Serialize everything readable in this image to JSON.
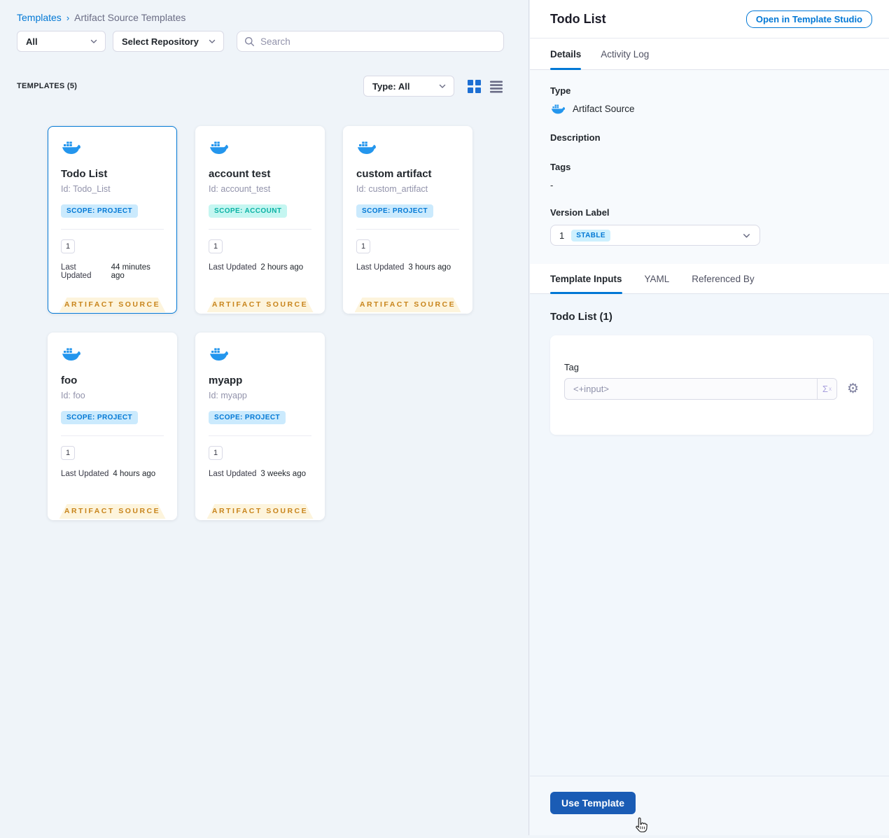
{
  "breadcrumb": {
    "link": "Templates",
    "separator": "›",
    "current": "Artifact Source Templates"
  },
  "filters": {
    "scope_dropdown": "All",
    "repository_dropdown": "Select Repository",
    "search_placeholder": "Search"
  },
  "list_header": {
    "count_label": "TEMPLATES (5)",
    "type_filter": "Type: All"
  },
  "cards": [
    {
      "title": "Todo List",
      "id": "Id: Todo_List",
      "scope": "SCOPE: PROJECT",
      "version_count": "1",
      "last_updated_label": "Last Updated",
      "last_updated": "44 minutes ago",
      "ribbon": "ARTIFACT SOURCE"
    },
    {
      "title": "account test",
      "id": "Id: account_test",
      "scope": "SCOPE: ACCOUNT",
      "version_count": "1",
      "last_updated_label": "Last Updated",
      "last_updated": "2 hours ago",
      "ribbon": "ARTIFACT SOURCE"
    },
    {
      "title": "custom artifact",
      "id": "Id: custom_artifact",
      "scope": "SCOPE: PROJECT",
      "version_count": "1",
      "last_updated_label": "Last Updated",
      "last_updated": "3 hours ago",
      "ribbon": "ARTIFACT SOURCE"
    },
    {
      "title": "foo",
      "id": "Id: foo",
      "scope": "SCOPE: PROJECT",
      "version_count": "1",
      "last_updated_label": "Last Updated",
      "last_updated": "4 hours ago",
      "ribbon": "ARTIFACT SOURCE"
    },
    {
      "title": "myapp",
      "id": "Id: myapp",
      "scope": "SCOPE: PROJECT",
      "version_count": "1",
      "last_updated_label": "Last Updated",
      "last_updated": "3 weeks ago",
      "ribbon": "ARTIFACT SOURCE"
    }
  ],
  "details_panel": {
    "title": "Todo List",
    "open_button": "Open in Template Studio",
    "tabs": [
      {
        "label": "Details"
      },
      {
        "label": "Activity Log"
      }
    ],
    "type_label": "Type",
    "type_value": "Artifact Source",
    "description_label": "Description",
    "tags_label": "Tags",
    "tags_value": "-",
    "version_label": "Version Label",
    "version_value": "1",
    "version_badge": "STABLE",
    "sub_tabs": [
      {
        "label": "Template Inputs"
      },
      {
        "label": "YAML"
      },
      {
        "label": "Referenced By"
      }
    ],
    "inputs_heading": "Todo List (1)",
    "tag_label": "Tag",
    "tag_value": "<+input>",
    "use_template_button": "Use Template"
  },
  "icons": {
    "expression": "Σ",
    "expression_sup": "x",
    "gear": "⚙"
  },
  "colors": {
    "accent_blue": "#0278d5",
    "docker_blue": "#2496ed",
    "button_blue": "#1a5cb5",
    "ribbon_text": "#c8841b",
    "ribbon_bg": "#fdf4dc",
    "scope_project_bg": "#cbeafd",
    "scope_account_bg": "#c5f6f1",
    "scope_account_text": "#0ab2a4",
    "panel_bg": "#eff4f9"
  }
}
